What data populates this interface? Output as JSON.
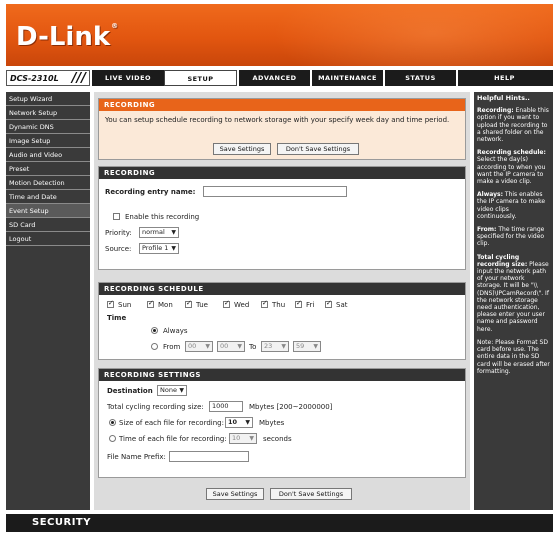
{
  "brand": {
    "logo_text": "D-Link",
    "reg_mark": "®"
  },
  "nav": {
    "model": "DCS-2310L",
    "model_slash": "///",
    "tabs": [
      "LIVE VIDEO",
      "SETUP",
      "ADVANCED",
      "MAINTENANCE",
      "STATUS",
      "HELP"
    ],
    "active_tab": "SETUP"
  },
  "sidebar": {
    "items": [
      "Setup Wizard",
      "Network Setup",
      "Dynamic DNS",
      "Image Setup",
      "Audio and Video",
      "Preset",
      "Motion Detection",
      "Time and Date",
      "Event Setup",
      "SD Card",
      "Logout"
    ],
    "selected": "Event Setup"
  },
  "intro": {
    "title": "RECORDING",
    "text": "You can setup schedule recording to network storage with your specify week day and time period.",
    "save_label": "Save Settings",
    "dont_save_label": "Don't Save Settings"
  },
  "recording": {
    "title": "RECORDING",
    "entry_name_label": "Recording entry name:",
    "entry_name_value": "",
    "enable_label": "Enable this recording",
    "enable_checked": false,
    "priority_label": "Priority:",
    "priority_value": "normal",
    "source_label": "Source:",
    "source_value": "Profile 1"
  },
  "schedule": {
    "title": "RECORDING SCHEDULE",
    "days": [
      "Sun",
      "Mon",
      "Tue",
      "Wed",
      "Thu",
      "Fri",
      "Sat"
    ],
    "time_label": "Time",
    "always_label": "Always",
    "from_label": "From",
    "from_hour": "00",
    "from_min": "00",
    "to_label": "To",
    "to_hour": "23",
    "to_min": "59"
  },
  "settings": {
    "title": "RECORDING SETTINGS",
    "destination_label": "Destination",
    "destination_value": "None",
    "cycling_label": "Total cycling recording size:",
    "cycling_value": "1000",
    "cycling_unit": "Mbytes [200~2000000]",
    "size_each_label": "Size of each file for recording:",
    "size_each_value": "10",
    "size_each_unit": "Mbytes",
    "time_each_label": "Time of each file for recording:",
    "time_each_value": "10",
    "time_each_unit": "seconds",
    "prefix_label": "File Name Prefix:",
    "prefix_value": ""
  },
  "bottom_buttons": {
    "save_label": "Save Settings",
    "dont_save_label": "Don't Save Settings"
  },
  "help": {
    "title": "Helpful Hints..",
    "hints": [
      {
        "head": "Recording:",
        "body": " Enable this option if you want to upload the recording to a shared folder on the network."
      },
      {
        "head": "Recording schedule:",
        "body": " Select the day(s) according to when you want the IP camera to make a video clip."
      },
      {
        "head": "Always:",
        "body": " This enables the IP camera to make video clips continuously."
      },
      {
        "head": "From:",
        "body": " The time range specified for the video clip."
      },
      {
        "head": "Total cycling recording size:",
        "body": " Please input the network path of your network storage. It will be \"\\\\(DNS)\\IPCamRecord\\\". If the network storage need authentication, please enter your user name and password here."
      },
      {
        "head": "",
        "body": "Note: Please Format SD card before use. The entire data in the SD card will be erased after formatting."
      }
    ]
  },
  "footer": {
    "label": "SECURITY"
  }
}
